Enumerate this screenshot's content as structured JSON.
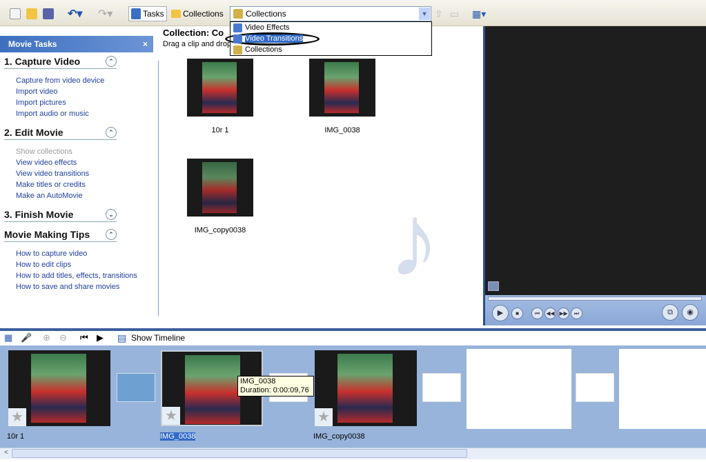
{
  "toolbar": {
    "tasks": "Tasks",
    "collections": "Collections",
    "combo_value": "Collections",
    "dropdown": [
      {
        "label": "Video Effects",
        "icon": "star-icon"
      },
      {
        "label": "Video Transitions",
        "icon": "transition-icon",
        "selected": true
      },
      {
        "label": "Collections",
        "icon": "collections-icon"
      }
    ]
  },
  "left": {
    "title": "Movie Tasks",
    "close": "×",
    "sections": [
      {
        "title": "1. Capture Video",
        "toggle": "⌃",
        "links": [
          "Capture from video device",
          "Import video",
          "Import pictures",
          "Import audio or music"
        ]
      },
      {
        "title": "2. Edit Movie",
        "toggle": "⌃",
        "links": [
          "Show collections",
          "View video effects",
          "View video transitions",
          "Make titles or credits",
          "Make an AutoMovie"
        ]
      },
      {
        "title": "3. Finish Movie",
        "toggle": "⌄",
        "links": []
      },
      {
        "title": "Movie Making Tips",
        "toggle": "⌃",
        "links": [
          "How to capture video",
          "How to edit clips",
          "How to add titles, effects, transitions",
          "How to save and share movies"
        ]
      }
    ]
  },
  "collection": {
    "title": "Collection: Co",
    "subtitle": "Drag a clip and drop",
    "items": [
      "10r 1",
      "IMG_0038",
      "IMG_copy0038"
    ]
  },
  "storyboard": {
    "show_timeline": "Show Timeline",
    "clips": [
      "10r 1",
      "IMG_0038",
      "IMG_copy0038"
    ],
    "tooltip": {
      "name": "IMG_0038",
      "duration": "Duration:  0:00:09,76"
    }
  },
  "colors": {
    "accent": "#316ac5",
    "storyboard_bg": "#98b4da",
    "link": "#1f3f9f"
  }
}
